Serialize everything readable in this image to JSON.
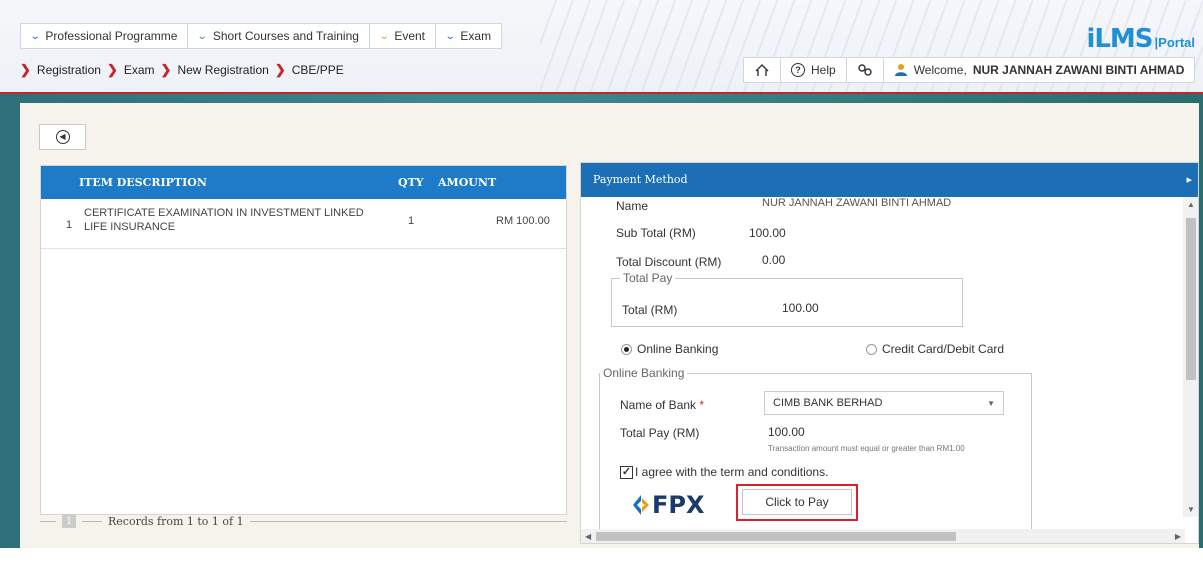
{
  "nav": {
    "items": [
      {
        "label": "Professional Programme",
        "chevron": "blue"
      },
      {
        "label": "Short Courses and Training",
        "chevron": "green"
      },
      {
        "label": "Event",
        "chevron": "orange"
      },
      {
        "label": "Exam",
        "chevron": "blue"
      }
    ]
  },
  "breadcrumb": [
    "Registration",
    "Exam",
    "New Registration",
    "CBE/PPE"
  ],
  "logo": {
    "main": "iLMS",
    "portal": "|Portal"
  },
  "toolbar": {
    "help": "Help",
    "welcome_prefix": "Welcome,",
    "user": "NUR JANNAH ZAWANI BINTI AHMAD"
  },
  "items_table": {
    "headers": {
      "description": "ITEM DESCRIPTION",
      "qty": "QTY",
      "amount": "AMOUNT"
    },
    "rows": [
      {
        "no": "1",
        "description_line1": "CERTIFICATE EXAMINATION IN INVESTMENT LINKED",
        "description_line2": "LIFE INSURANCE",
        "qty": "1",
        "amount": "RM 100.00"
      }
    ],
    "page": "1",
    "records": "Records from 1 to 1 of 1"
  },
  "payment": {
    "title": "Payment Method",
    "name_label": "Name",
    "name_value": "NUR JANNAH ZAWANI BINTI AHMAD",
    "subtotal_label": "Sub Total (RM)",
    "subtotal_value": "100.00",
    "discount_label": "Total Discount (RM)",
    "discount_value": "0.00",
    "total_pay_legend": "Total Pay",
    "total_label": "Total (RM)",
    "total_value": "100.00",
    "method_online": "Online Banking",
    "method_card": "Credit Card/Debit Card",
    "selected_method": "Online Banking",
    "online_legend": "Online Banking",
    "bank_label": "Name of Bank",
    "bank_required": "*",
    "bank_value": "CIMB BANK BERHAD",
    "total_pay_label": "Total Pay (RM)",
    "total_pay_value": "100.00",
    "note": "Transaction amount must equal or greater than RM1.00",
    "agree_label": "I agree with the term and conditions.",
    "agree_checked": true,
    "fpx": "FPX",
    "pay_button": "Click to Pay"
  },
  "colors": {
    "accent": "#1d7bc8",
    "brand_red": "#c0282d",
    "highlight": "#d9222a"
  }
}
